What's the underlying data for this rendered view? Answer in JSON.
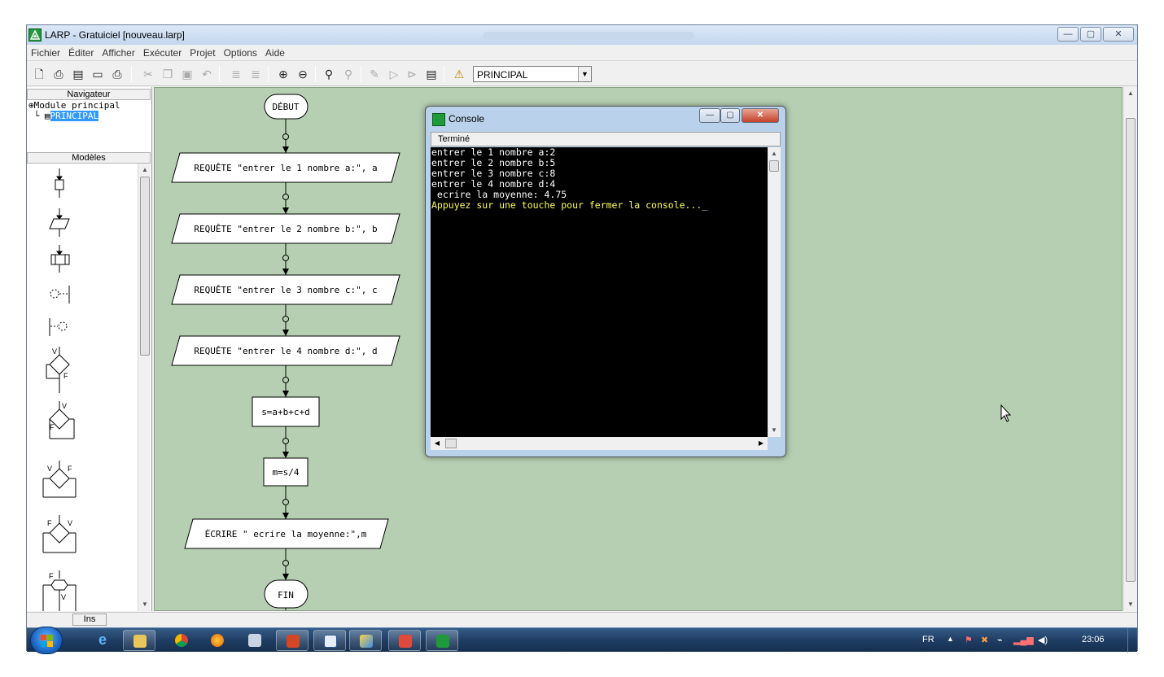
{
  "window": {
    "title": "LARP - Gratuiciel [nouveau.larp]",
    "buttons": {
      "minimize": "—",
      "maximize": "▢",
      "close": "✕"
    }
  },
  "menu": [
    "Fichier",
    "Éditer",
    "Afficher",
    "Exécuter",
    "Projet",
    "Options",
    "Aide"
  ],
  "toolbar": {
    "module_select": "PRINCIPAL",
    "icons": [
      "new-icon",
      "print-preview-icon",
      "export-icon",
      "open-folder-icon",
      "print-icon",
      "cut-icon",
      "copy-icon",
      "paste-icon",
      "undo-icon",
      "indent-icon",
      "outdent-icon",
      "zoom-in-icon",
      "zoom-out-icon",
      "find-icon",
      "replace-icon",
      "compile-icon",
      "run-icon",
      "step-icon",
      "console-icon",
      "warning-icon"
    ]
  },
  "navigator": {
    "header": "Navigateur",
    "tree": [
      "Module principal",
      "PRINCIPAL"
    ]
  },
  "models": {
    "header": "Modèles"
  },
  "flowchart": {
    "start": "DÉBUT",
    "steps": [
      "REQUÊTE \"entrer le 1 nombre a:\", a",
      "REQUÊTE \"entrer le 2 nombre b:\", b",
      "REQUÊTE \"entrer le 3 nombre c:\", c",
      "REQUÊTE \"entrer le 4 nombre d:\", d",
      "s=a+b+c+d",
      "m=s/4",
      "ÉCRIRE \" ecrire la moyenne:\",m"
    ],
    "end": "FIN",
    "background_color": "#b6cfb2"
  },
  "console": {
    "title": "Console",
    "status": "Terminé",
    "lines": [
      "entrer le 1 nombre a:2",
      "entrer le 2 nombre b:5",
      "entrer le 3 nombre c:8",
      "entrer le 4 nombre d:4",
      " ecrire la moyenne: 4.75",
      "",
      "Appuyez sur une touche pour fermer la console..._"
    ]
  },
  "statusbar": {
    "mode": "Ins"
  },
  "taskbar": {
    "language": "FR",
    "clock": "23:06",
    "apps": [
      "internet-explorer-icon",
      "explorer-icon",
      "chrome-icon",
      "firefox-icon",
      "remote-icon",
      "powerpoint-icon",
      "word-icon",
      "paint-icon",
      "acrobat-icon",
      "larp-icon"
    ]
  }
}
